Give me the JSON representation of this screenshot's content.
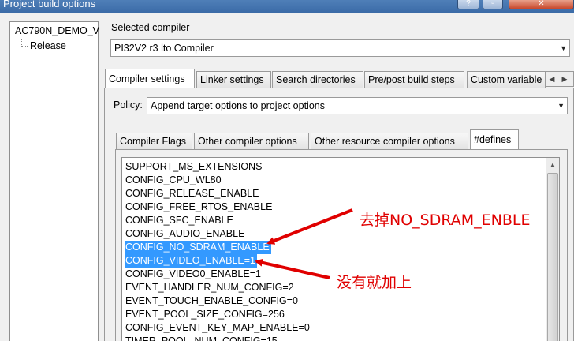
{
  "window": {
    "title": "Project build options",
    "buttons": [
      "?",
      "▫",
      "✕"
    ]
  },
  "tree": {
    "root": "AC790N_DEMO_V",
    "child": "Release"
  },
  "compiler": {
    "label": "Selected compiler",
    "value": "PI32V2 r3 lto Compiler"
  },
  "main_tabs": [
    "Compiler settings",
    "Linker settings",
    "Search directories",
    "Pre/post build steps",
    "Custom variable"
  ],
  "policy": {
    "label": "Policy:",
    "value": "Append target options to project options"
  },
  "sub_tabs": [
    "Compiler Flags",
    "Other compiler options",
    "Other resource compiler options",
    "#defines"
  ],
  "defines": [
    {
      "text": "SUPPORT_MS_EXTENSIONS",
      "selected": false
    },
    {
      "text": "CONFIG_CPU_WL80",
      "selected": false
    },
    {
      "text": "CONFIG_RELEASE_ENABLE",
      "selected": false
    },
    {
      "text": "CONFIG_FREE_RTOS_ENABLE",
      "selected": false
    },
    {
      "text": "CONFIG_SFC_ENABLE",
      "selected": false
    },
    {
      "text": "CONFIG_AUDIO_ENABLE",
      "selected": false
    },
    {
      "text": "CONFIG_NO_SDRAM_ENABLE",
      "selected": true
    },
    {
      "text": "CONFIG_VIDEO_ENABLE=1",
      "selected": true
    },
    {
      "text": "CONFIG_VIDEO0_ENABLE=1",
      "selected": false
    },
    {
      "text": "EVENT_HANDLER_NUM_CONFIG=2",
      "selected": false
    },
    {
      "text": "EVENT_TOUCH_ENABLE_CONFIG=0",
      "selected": false
    },
    {
      "text": "EVENT_POOL_SIZE_CONFIG=256",
      "selected": false
    },
    {
      "text": "CONFIG_EVENT_KEY_MAP_ENABLE=0",
      "selected": false
    },
    {
      "text": "TIMER_POOL_NUM_CONFIG=15",
      "selected": false
    }
  ],
  "annotations": {
    "remove_note": "去掉NO_SDRAM_ENBLE",
    "add_note": "没有就加上",
    "color": "#e00000"
  },
  "colors": {
    "selection": "#3399ff"
  }
}
